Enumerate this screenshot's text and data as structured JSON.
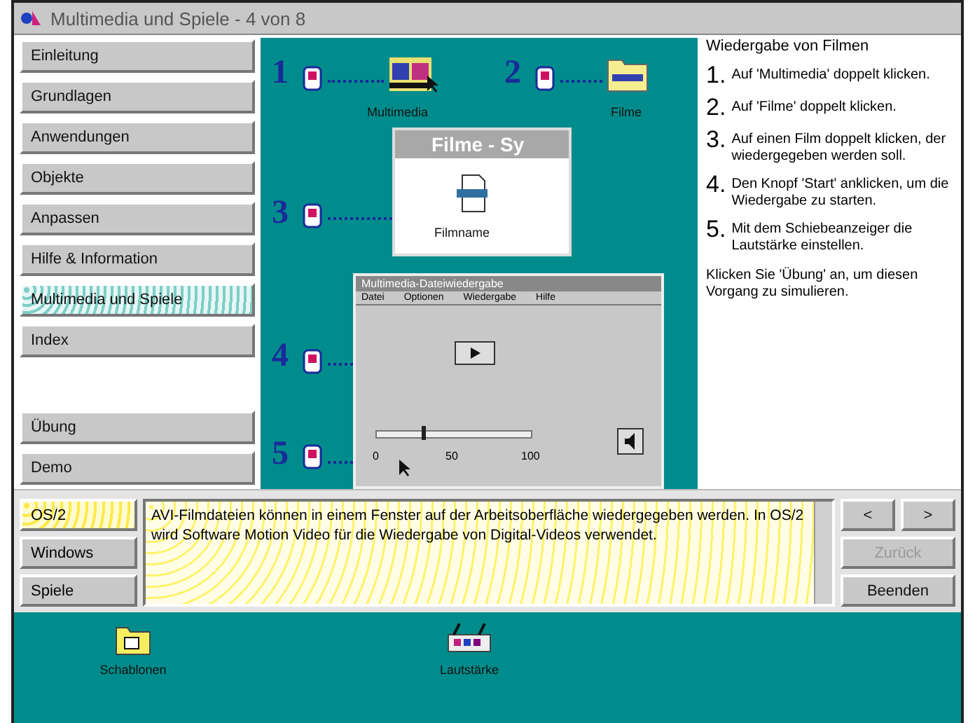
{
  "window": {
    "title": "Multimedia und Spiele - 4 von 8"
  },
  "sidebar": {
    "items": [
      {
        "label": "Einleitung",
        "selected": false
      },
      {
        "label": "Grundlagen",
        "selected": false
      },
      {
        "label": "Anwendungen",
        "selected": false
      },
      {
        "label": "Objekte",
        "selected": false
      },
      {
        "label": "Anpassen",
        "selected": false
      },
      {
        "label": "Hilfe & Information",
        "selected": false
      },
      {
        "label": "Multimedia und Spiele",
        "selected": true
      },
      {
        "label": "Index",
        "selected": false
      }
    ],
    "bottom_items": [
      {
        "label": "Übung"
      },
      {
        "label": "Demo"
      }
    ]
  },
  "illustration": {
    "steps": [
      "1",
      "2",
      "3",
      "4",
      "5"
    ],
    "icon_labels": [
      "Multimedia",
      "Filme"
    ],
    "folder_window_title": "Filme - Sy",
    "file_label": "Filmname",
    "player_title": "Multimedia-Dateiwiedergabe",
    "player_menu": [
      "Datei",
      "Optionen",
      "Wiedergabe",
      "Hilfe"
    ],
    "volume": {
      "level": 0.3
    },
    "volume_min": "0",
    "volume_mid": "50",
    "volume_max": "100"
  },
  "instructions": {
    "title": "Wiedergabe von Filmen",
    "steps": [
      {
        "number": "1.",
        "text": "Auf 'Multimedia' doppelt klicken."
      },
      {
        "number": "2.",
        "text": "Auf 'Filme' doppelt klicken."
      },
      {
        "number": "3.",
        "text": "Auf einen Film doppelt klicken, der wiedergegeben werden soll."
      },
      {
        "number": "4.",
        "text": "Den Knopf 'Start' anklicken, um die Wiedergabe zu starten."
      },
      {
        "number": "5.",
        "text": "Mit dem Schiebeanzeiger die Lautstärke einstellen."
      }
    ],
    "note": "Klicken Sie 'Übung' an, um diesen Vorgang zu simulieren."
  },
  "topic_buttons": [
    {
      "label": "OS/2",
      "selected": true
    },
    {
      "label": "Windows",
      "selected": false
    },
    {
      "label": "Spiele",
      "selected": false
    }
  ],
  "description": "AVI-Filmdateien können in einem Fenster auf der Arbeitsoberfläche wiedergegeben werden. In OS/2 wird Software Motion Video für die Wiedergabe von Digital-Videos verwendet.",
  "nav": {
    "prev": "<",
    "next": ">",
    "back": {
      "label": "Zurück",
      "disabled": true
    },
    "exit": "Beenden"
  },
  "desktop_icons": [
    {
      "label": "Schablonen",
      "kind": "folder"
    },
    {
      "label": "Lautstärke",
      "kind": "device"
    }
  ]
}
